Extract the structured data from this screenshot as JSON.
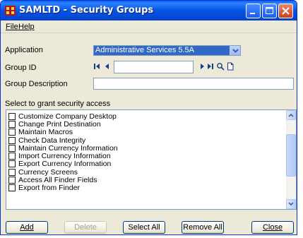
{
  "window": {
    "title": "SAMLTD - Security Groups"
  },
  "menu": [
    {
      "label": "File"
    },
    {
      "label": "Help"
    }
  ],
  "form": {
    "application_label": "Application",
    "application_value": "Administrative Services 5.5A",
    "group_id_label": "Group ID",
    "group_id_value": "",
    "group_description_label": "Group Description",
    "group_description_value": ""
  },
  "security": {
    "section_label": "Select to grant security access",
    "items": [
      "Customize Company Desktop",
      "Change Print Destination",
      "Maintain Macros",
      "Check Data Integrity",
      "Maintain Currency Information",
      "Import Currency Information",
      "Export Currency Information",
      "Currency Screens",
      "Access All Finder Fields",
      "Export from Finder"
    ]
  },
  "buttons": {
    "add": "Add",
    "delete": "Delete",
    "select_all": "Select All",
    "remove_all": "Remove All",
    "close": "Close"
  },
  "colors": {
    "titlebar": "#0554e3",
    "selection": "#316ac5",
    "face": "#ece9d8"
  }
}
